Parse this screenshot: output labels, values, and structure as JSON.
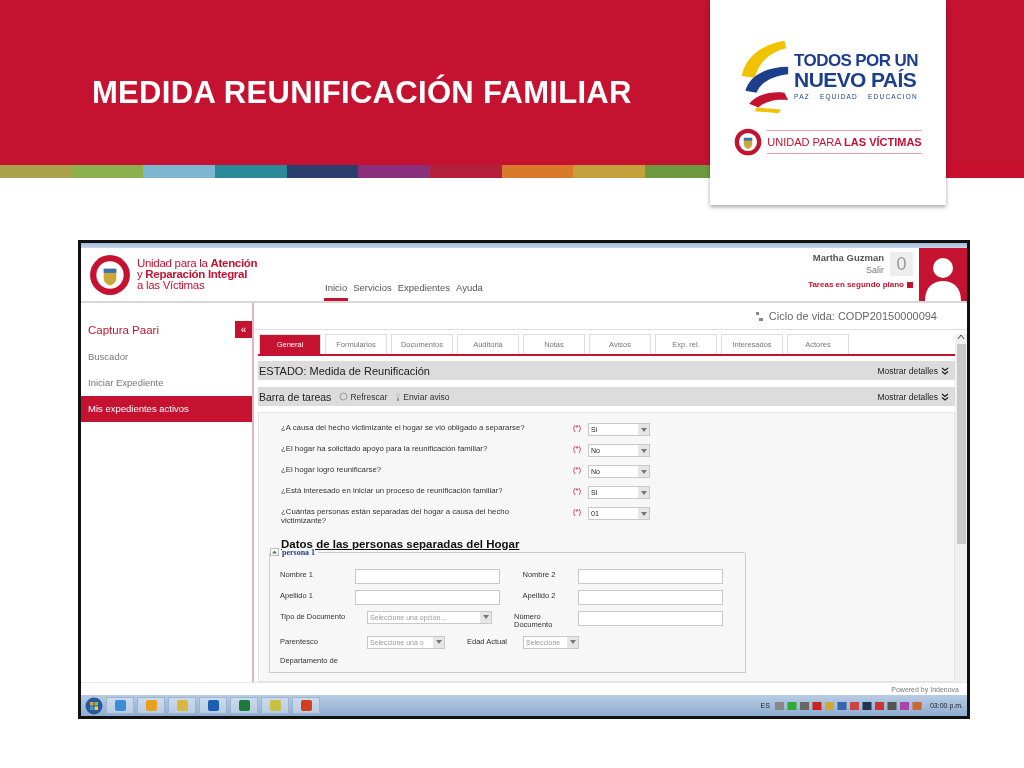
{
  "slide": {
    "title": "MEDIDA REUNIFICACIÓN FAMILIAR"
  },
  "brand_card": {
    "tagline": [
      "TODOS POR UN",
      "NUEVO PAÍS"
    ],
    "motto": [
      "PAZ",
      "EQUIDAD",
      "EDUCACION"
    ],
    "unit": "UNIDAD PARA **LAS VÍCTIMAS**"
  },
  "app": {
    "logo_lines": [
      "Unidad para la **Atención**",
      "y **Reparación Integral**",
      "a las Víctimas"
    ],
    "nav": [
      {
        "label": "Inicio",
        "selected": true
      },
      {
        "label": "Servicios",
        "selected": false
      },
      {
        "label": "Expedientes",
        "selected": false
      },
      {
        "label": "Ayuda",
        "selected": false
      }
    ],
    "user": {
      "name": "Martha Guzman",
      "logout": "Salir",
      "counter": "0",
      "background_tasks": "Tareas en segundo plano"
    },
    "sidebar": {
      "title": "Captura Paari",
      "collapse": "«",
      "items": [
        {
          "label": "Buscador",
          "selected": false
        },
        {
          "label": "Iniciar Expediente",
          "selected": false
        },
        {
          "label": "Mis expedientes activos",
          "selected": true
        }
      ]
    },
    "lifecycle": "Ciclo de vida: CODP20150000094",
    "tabs": [
      {
        "label": "General",
        "selected": true
      },
      {
        "label": "Formularios",
        "selected": false
      },
      {
        "label": "Documentos",
        "selected": false
      },
      {
        "label": "Auditoria",
        "selected": false
      },
      {
        "label": "Notas",
        "selected": false
      },
      {
        "label": "Avisos",
        "selected": false
      },
      {
        "label": "Exp. rel.",
        "selected": false
      },
      {
        "label": "Interesados",
        "selected": false
      },
      {
        "label": "Actores",
        "selected": false
      }
    ],
    "status_bar": {
      "text": "ESTADO: Medida de Reunificación",
      "toggle": "Mostrar detalles"
    },
    "task_bar": {
      "label": "Barra de tareas",
      "actions": [
        "Refrescar",
        "Enviar aviso"
      ],
      "toggle": "Mostrar detalles"
    },
    "questions": [
      {
        "text": "¿A causa del hecho victimizante el hogar se vió obligado a separarse?",
        "required": "(*)",
        "value": "Si"
      },
      {
        "text": "¿El hogar ha solicitado apoyo para la reunificación familiar?",
        "required": "(*)",
        "value": "No"
      },
      {
        "text": "¿El hogar logró reunificarse?",
        "required": "(*)",
        "value": "No"
      },
      {
        "text": "¿Está interesado en iniciar un proceso de reunificación familiar?",
        "required": "(*)",
        "value": "Si"
      },
      {
        "text": "¿Cuántas personas están separadas del hogar a causa del hecho victimizante?",
        "required": "(*)",
        "value": "01"
      }
    ],
    "section_title": "Datos de las personas separadas del Hogar",
    "person": {
      "legend": "persona 1",
      "expanded": true,
      "rows": [
        [
          {
            "label": "Nombre 1",
            "kind": "text"
          },
          {
            "label": "Nombre 2",
            "kind": "text"
          }
        ],
        [
          {
            "label": "Apellido 1",
            "kind": "text"
          },
          {
            "label": "Apellido 2",
            "kind": "text"
          }
        ],
        [
          {
            "label": "Tipo de Documento",
            "kind": "select",
            "placeholder": "Seleccione una opción..."
          },
          {
            "label": "Número Documento",
            "kind": "text"
          }
        ],
        [
          {
            "label": "Parentesco",
            "kind": "select",
            "placeholder": "Seleccione una o"
          },
          {
            "label": "Edad Actual",
            "kind": "select",
            "placeholder": "Seleccione"
          }
        ],
        [
          {
            "label": "Departamento de",
            "kind": "none"
          }
        ]
      ]
    },
    "footer": "Powered by Indenova",
    "taskbar": {
      "language": "ES",
      "clock": "03:00 p.m."
    }
  }
}
